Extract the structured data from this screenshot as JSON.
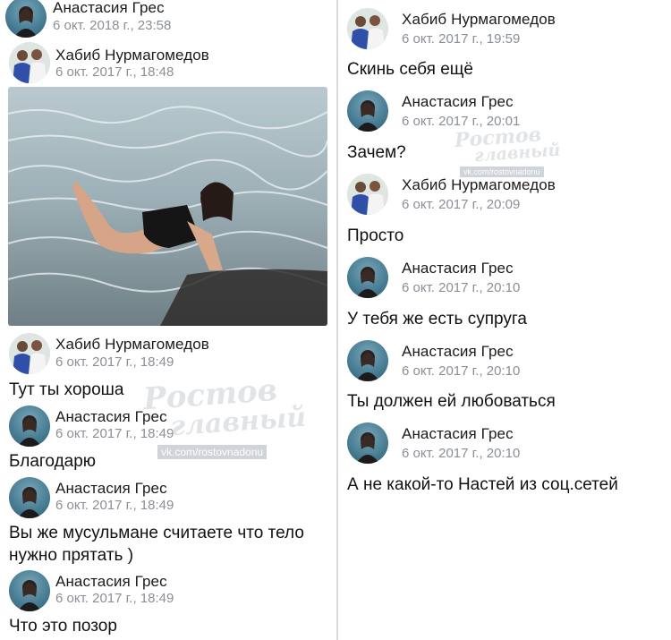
{
  "left": {
    "messages": [
      {
        "author": "Анастасия Грес",
        "time": "6 окт. 2018 г., 23:58",
        "text": ""
      },
      {
        "author": "Хабиб Нурмагомедов",
        "time": "6 окт. 2017 г., 18:48",
        "text": ""
      },
      {
        "author": "Хабиб Нурмагомедов",
        "time": "6 окт. 2017 г., 18:49",
        "text": "Тут ты хороша"
      },
      {
        "author": "Анастасия Грес",
        "time": "6 окт. 2017 г., 18:49",
        "text": "Благодарю"
      },
      {
        "author": "Анастасия Грес",
        "time": "6 окт. 2017 г., 18:49",
        "text": "Вы же мусульмане считаете что тело\nнужно прятать )"
      },
      {
        "author": "Анастасия Грес",
        "time": "6 окт. 2017 г., 18:49",
        "text": "Что это позор"
      }
    ]
  },
  "right": {
    "messages": [
      {
        "author": "Хабиб Нурмагомедов",
        "time": "6 окт. 2017 г., 19:59",
        "text": "Скинь себя ещё"
      },
      {
        "author": "Анастасия Грес",
        "time": "6 окт. 2017 г., 20:01",
        "text": "Зачем?"
      },
      {
        "author": "Хабиб Нурмагомедов",
        "time": "6 окт. 2017 г., 20:09",
        "text": "Просто"
      },
      {
        "author": "Анастасия Грес",
        "time": "6 окт. 2017 г., 20:10",
        "text": "У тебя же есть супруга"
      },
      {
        "author": "Анастасия Грес",
        "time": "6 окт. 2017 г., 20:10",
        "text": "Ты должен ей любоваться"
      },
      {
        "author": "Анастасия Грес",
        "time": "6 окт. 2017 г., 20:10",
        "text": "А не какой-то Настей из соц.сетей"
      }
    ]
  },
  "watermark": {
    "logo_line1": "Ростов",
    "logo_line2": "главный",
    "url": "vk.com/rostovnadonu"
  },
  "colors": {
    "name": "#1b1b1b",
    "time": "#8a8f96",
    "divider": "#d9dde3"
  }
}
